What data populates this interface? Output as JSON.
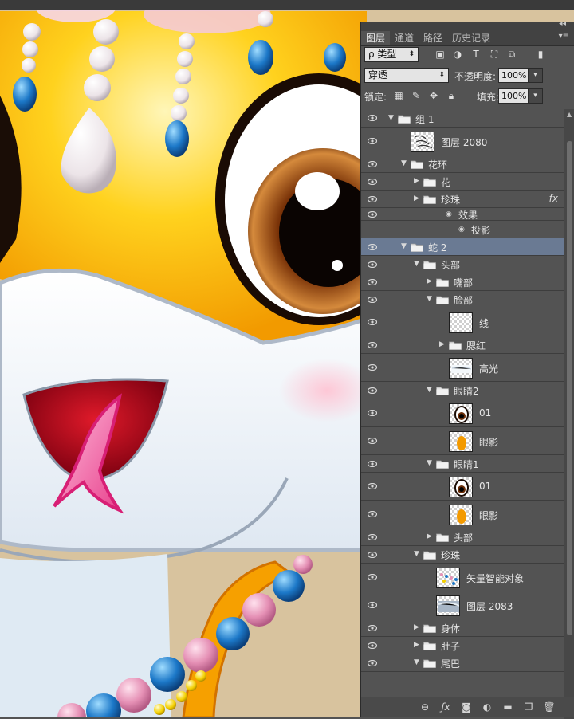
{
  "tabs": [
    {
      "label": "图层",
      "active": true
    },
    {
      "label": "通道",
      "active": false
    },
    {
      "label": "路径",
      "active": false
    },
    {
      "label": "历史记录",
      "active": false
    }
  ],
  "filter": {
    "kind_label": "ρ 类型"
  },
  "blend": {
    "mode": "穿透",
    "opacity_label": "不透明度:",
    "opacity_value": "100%"
  },
  "lock": {
    "label": "锁定:",
    "fill_label": "填充:",
    "fill_value": "100%"
  },
  "layers": [
    {
      "name": "组 1",
      "kind": "group",
      "depth": 0,
      "expanded": true
    },
    {
      "name": "图层 2080",
      "kind": "layer",
      "depth": 1,
      "thumb": "sketch"
    },
    {
      "name": "花环",
      "kind": "group",
      "depth": 1,
      "expanded": true
    },
    {
      "name": "花",
      "kind": "group",
      "depth": 2,
      "expanded": false
    },
    {
      "name": "珍珠",
      "kind": "group",
      "depth": 2,
      "expanded": false,
      "fx": "fx"
    },
    {
      "name": "效果",
      "kind": "effect",
      "depth": 3
    },
    {
      "name": "投影",
      "kind": "effect-item",
      "depth": 4
    },
    {
      "name": "蛇 2",
      "kind": "group",
      "depth": 1,
      "expanded": true,
      "selected": true
    },
    {
      "name": "头部",
      "kind": "group",
      "depth": 2,
      "expanded": true
    },
    {
      "name": "嘴部",
      "kind": "group",
      "depth": 3,
      "expanded": false
    },
    {
      "name": "脸部",
      "kind": "group",
      "depth": 3,
      "expanded": true
    },
    {
      "name": "线",
      "kind": "layer",
      "depth": 4,
      "thumb": "blank"
    },
    {
      "name": "腮红",
      "kind": "group",
      "depth": 4,
      "expanded": false
    },
    {
      "name": "高光",
      "kind": "layer",
      "depth": 4,
      "thumb": "light"
    },
    {
      "name": "眼睛2",
      "kind": "group",
      "depth": 3,
      "expanded": true
    },
    {
      "name": "01",
      "kind": "layer",
      "depth": 4,
      "thumb": "eye"
    },
    {
      "name": "眼影",
      "kind": "layer",
      "depth": 4,
      "thumb": "orange"
    },
    {
      "name": "眼睛1",
      "kind": "group",
      "depth": 3,
      "expanded": true
    },
    {
      "name": "01",
      "kind": "layer",
      "depth": 4,
      "thumb": "eye"
    },
    {
      "name": "眼影",
      "kind": "layer",
      "depth": 4,
      "thumb": "orange"
    },
    {
      "name": "头部",
      "kind": "group",
      "depth": 3,
      "expanded": false
    },
    {
      "name": "珍珠",
      "kind": "group",
      "depth": 2,
      "expanded": true
    },
    {
      "name": "矢量智能对象",
      "kind": "layer",
      "depth": 3,
      "thumb": "dots"
    },
    {
      "name": "图层 2083",
      "kind": "layer",
      "depth": 3,
      "thumb": "grey"
    },
    {
      "name": "身体",
      "kind": "group",
      "depth": 2,
      "expanded": false
    },
    {
      "name": "肚子",
      "kind": "group",
      "depth": 2,
      "expanded": false
    },
    {
      "name": "尾巴",
      "kind": "group",
      "depth": 2,
      "expanded": true
    }
  ],
  "colors": {
    "panel": "#535353",
    "selected_row": "#6a7a93",
    "snake_skin": "#eef3f8",
    "head_yellow": "#ffd21e",
    "tongue": "#e8438e",
    "pearl_blue": "#1c78c8"
  },
  "icons": [
    "eye-icon",
    "folder-icon",
    "link-icon",
    "fx-icon",
    "mask-icon",
    "adjustment-icon",
    "new-group-icon",
    "new-layer-icon",
    "trash-icon"
  ]
}
